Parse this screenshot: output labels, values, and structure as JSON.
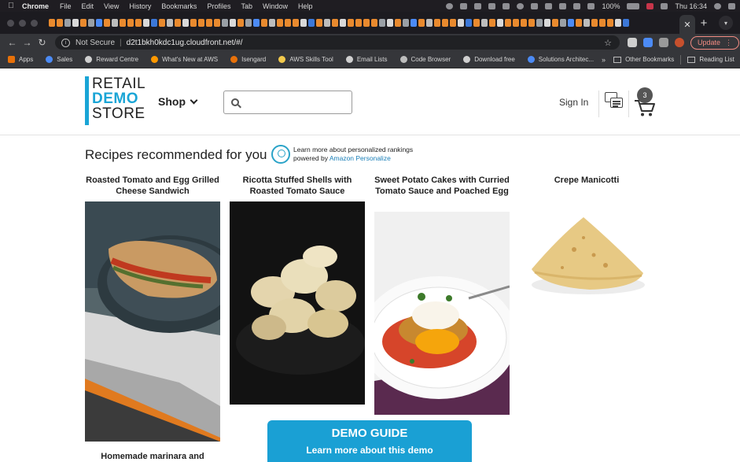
{
  "menubar": {
    "app": "Chrome",
    "items": [
      "File",
      "Edit",
      "View",
      "History",
      "Bookmarks",
      "Profiles",
      "Tab",
      "Window",
      "Help"
    ],
    "battery": "100%",
    "clock": "Thu 16:34"
  },
  "browser": {
    "url_security": "Not Secure",
    "url": "d2t1bkh0kdc1ug.cloudfront.net/#/",
    "update_label": "Update",
    "bookmarks": [
      {
        "label": "Apps",
        "color": "#e8710a"
      },
      {
        "label": "Sales",
        "color": "#4c8bf5"
      },
      {
        "label": "Reward Centre",
        "color": "#d0d0d0"
      },
      {
        "label": "What's New at AWS",
        "color": "#ff9900"
      },
      {
        "label": "Isengard",
        "color": "#e8710a"
      },
      {
        "label": "AWS Skills Tool",
        "color": "#f2c94c"
      },
      {
        "label": "Email Lists",
        "color": "#d0d0d0"
      },
      {
        "label": "Code Browser",
        "color": "#bdbdbd"
      },
      {
        "label": "Download free",
        "color": "#d0d0d0"
      },
      {
        "label": "Solutions Architec...",
        "color": "#4c8bf5"
      }
    ],
    "bookmarks_more": "»",
    "other_bookmarks": "Other Bookmarks",
    "reading_list": "Reading List"
  },
  "header": {
    "logo_line1": "RETAIL",
    "logo_line2": "DEMO",
    "logo_line3": "STORE",
    "shop_label": "Shop",
    "search_placeholder": "",
    "signin_label": "Sign In",
    "cart_count": "3",
    "accent_color": "#1aa5d6"
  },
  "content": {
    "section_title": "Recipes recommended for you",
    "personalize_line1": "Learn more about personalized rankings",
    "personalize_line2_prefix": "powered by ",
    "personalize_link": "Amazon Personalize",
    "recipes": [
      {
        "title": "Roasted Tomato and Egg Grilled Cheese Sandwich"
      },
      {
        "title": "Ricotta Stuffed Shells with Roasted Tomato Sauce"
      },
      {
        "title": "Sweet Potato Cakes with Curried Tomato Sauce and Poached Egg"
      },
      {
        "title": "Crepe Manicotti"
      }
    ],
    "next_row_title": "Homemade marinara and"
  },
  "demo_guide": {
    "title": "DEMO GUIDE",
    "subtitle": "Learn more about this demo"
  }
}
